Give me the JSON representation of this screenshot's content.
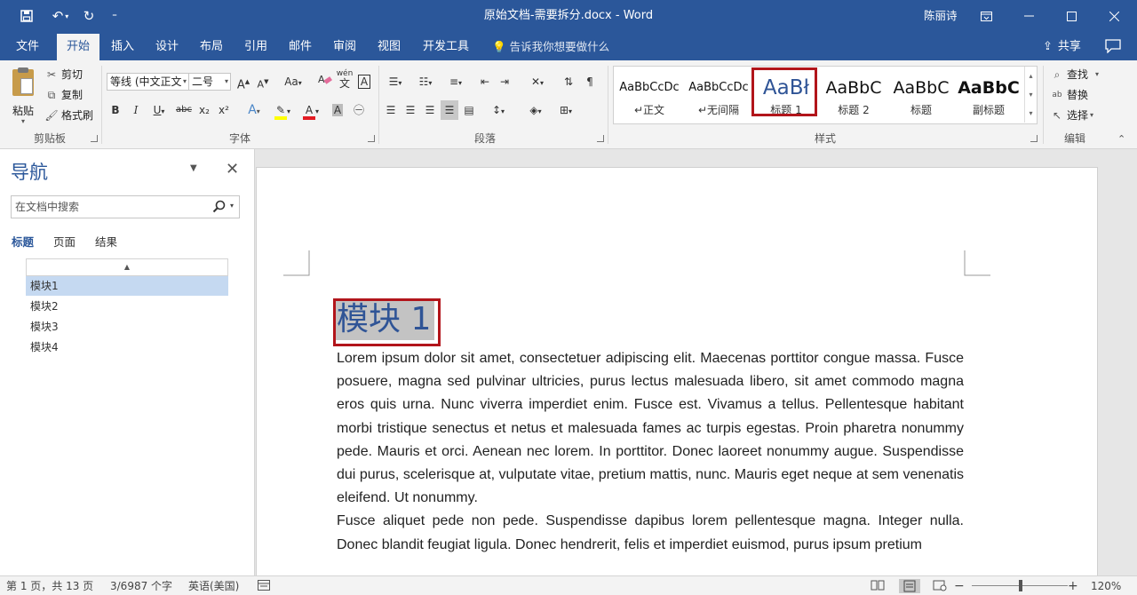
{
  "title_bar": {
    "title": "原始文档-需要拆分.docx  -  Word",
    "user": "陈丽诗",
    "qat_customize": "⁼"
  },
  "menu": {
    "tabs": [
      "文件",
      "开始",
      "插入",
      "设计",
      "布局",
      "引用",
      "邮件",
      "审阅",
      "视图",
      "开发工具"
    ],
    "active_tab": "开始",
    "tell_me": "告诉我你想要做什么",
    "share": "共享"
  },
  "ribbon": {
    "clipboard": {
      "paste": "粘贴",
      "cut": "剪切",
      "copy": "复制",
      "format_painter": "格式刷",
      "label": "剪贴板"
    },
    "font": {
      "font_name": "等线 (中文正文",
      "font_size": "二号",
      "case_label": "Aa",
      "label": "字体",
      "buttons": {
        "bold": "B",
        "italic": "I",
        "underline": "U",
        "strike": "abc",
        "sub": "x₂",
        "sup": "x²",
        "grow": "A",
        "shrink": "A",
        "effects": "A",
        "font_color": "A",
        "shading": "A",
        "phonetic": "wén",
        "border_char": "A",
        "enclose": "㊀"
      }
    },
    "paragraph": {
      "label": "段落"
    },
    "styles": {
      "label": "样式",
      "items": [
        {
          "sample": "AaBbCcDc",
          "name": "正文",
          "prefix": "↵"
        },
        {
          "sample": "AaBbCcDc",
          "name": "无间隔",
          "prefix": "↵"
        },
        {
          "sample": "AaBł",
          "name": "标题 1",
          "prefix": ""
        },
        {
          "sample": "AaBbC",
          "name": "标题 2",
          "prefix": ""
        },
        {
          "sample": "AaBbC",
          "name": "标题",
          "prefix": ""
        },
        {
          "sample": "AaBbC",
          "name": "副标题",
          "prefix": ""
        }
      ]
    },
    "editing": {
      "find": "查找",
      "replace": "替换",
      "select": "选择",
      "label": "编辑"
    }
  },
  "nav_pane": {
    "title": "导航",
    "search_placeholder": "在文档中搜索",
    "tabs": [
      "标题",
      "页面",
      "结果"
    ],
    "active_tab": "标题",
    "headings": [
      "模块1",
      "模块2",
      "模块3",
      "模块4"
    ],
    "selected_heading": "模块1"
  },
  "document": {
    "heading": "模块 1",
    "paragraphs": [
      "Lorem ipsum dolor sit amet, consectetuer adipiscing elit. Maecenas porttitor congue massa. Fusce posuere, magna sed pulvinar ultricies, purus lectus malesuada libero, sit amet commodo magna eros quis urna. Nunc viverra imperdiet enim. Fusce est. Vivamus a tellus. Pellentesque habitant morbi tristique senectus et netus et malesuada fames ac turpis egestas. Proin pharetra nonummy pede. Mauris et orci. Aenean nec lorem. In porttitor. Donec laoreet nonummy augue. Suspendisse dui purus, scelerisque at, vulputate vitae, pretium mattis, nunc. Mauris eget neque at sem venenatis eleifend. Ut nonummy.",
      "Fusce aliquet pede non pede. Suspendisse dapibus lorem pellentesque magna. Integer nulla. Donec blandit feugiat ligula. Donec hendrerit, felis et imperdiet euismod, purus ipsum pretium"
    ]
  },
  "status_bar": {
    "page": "第 1 页，共 13 页",
    "words": "3/6987 个字",
    "language": "英语(美国)",
    "zoom": "120%",
    "zoom_level": 1.2
  },
  "colors": {
    "title_bar": "#2b579a",
    "heading_text": "#2f5496",
    "highlight_box": "#b2151b",
    "nav_selected": "#c5d9f1"
  }
}
